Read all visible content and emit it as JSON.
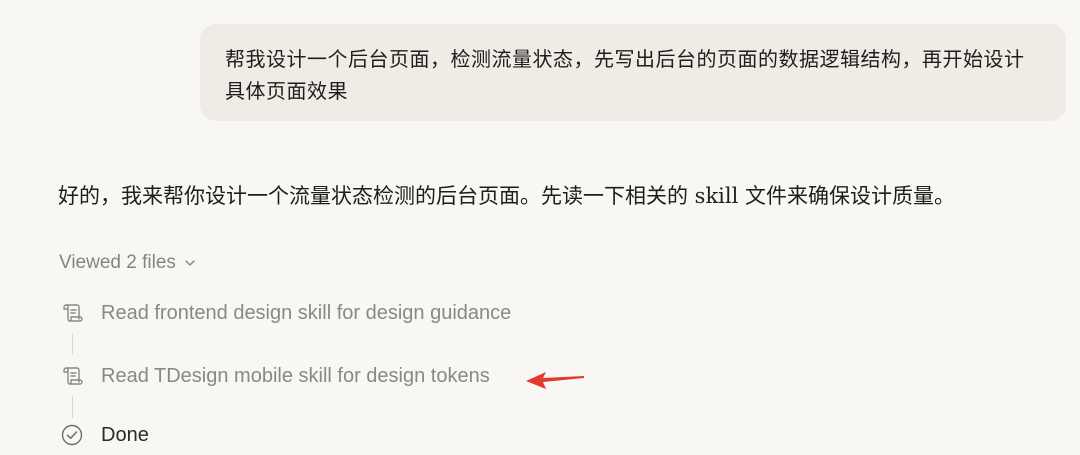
{
  "user_message": {
    "text": "帮我设计一个后台页面，检测流量状态，先写出后台的页面的数据逻辑结构，再开始设计具体页面效果"
  },
  "assistant": {
    "reply": "好的，我来帮你设计一个流量状态检测的后台页面。先读一下相关的 skill 文件来确保设计质量。",
    "viewed_files_label": "Viewed 2 files",
    "steps": [
      {
        "label": "Read frontend design skill for design guidance",
        "icon": "scroll-icon"
      },
      {
        "label": "Read TDesign mobile skill for design tokens",
        "icon": "scroll-icon"
      },
      {
        "label": "Done",
        "icon": "check-circle-icon"
      }
    ]
  },
  "colors": {
    "background": "#f8f7f3",
    "bubble": "#efece6",
    "muted_text": "#8a8882",
    "annotation_arrow": "#e23b2e"
  }
}
